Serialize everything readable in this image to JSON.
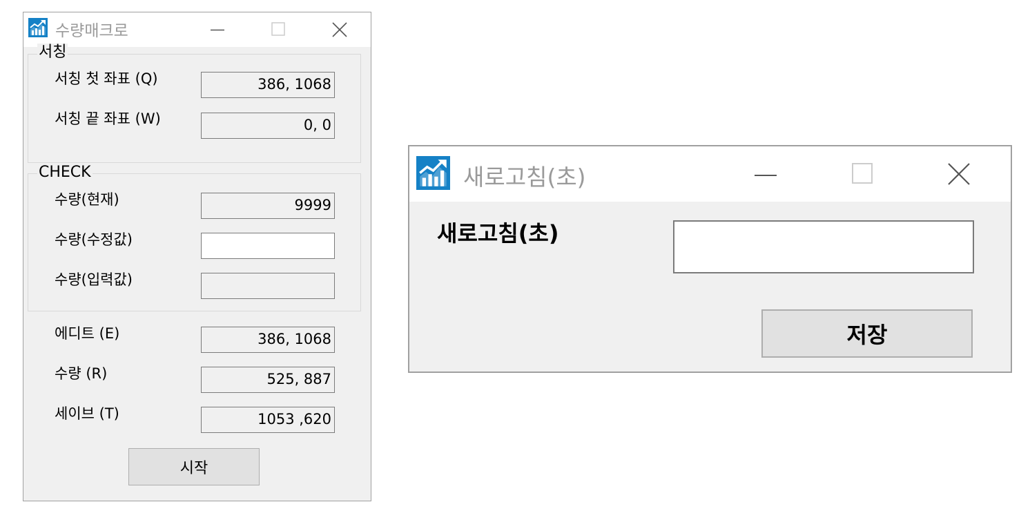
{
  "colors": {
    "window_bg": "#f0f0f0",
    "titlebar_bg": "#ffffff",
    "icon_blue": "#1581c6",
    "title_text": "#9a9a9a",
    "field_border": "#7a7a7a",
    "button_bg": "#e1e1e1"
  },
  "window1": {
    "title": "수량매크로",
    "icons": {
      "app": "chart-icon",
      "minimize": "minimize-icon",
      "maximize": "maximize-icon",
      "close": "close-icon"
    },
    "group_searching": {
      "title": "서칭",
      "first_label": "서칭 첫 좌표 (Q)",
      "first_value": "386, 1068",
      "last_label": "서칭 끝 좌표 (W)",
      "last_value": "0, 0"
    },
    "group_check": {
      "title": "CHECK",
      "current_label": "수량(현재)",
      "current_value": "9999",
      "modified_label": "수량(수정값)",
      "modified_value": "",
      "input_label": "수량(입력값)",
      "input_value": ""
    },
    "edit_label": "에디트 (E)",
    "edit_value": "386, 1068",
    "quantity_label": "수량 (R)",
    "quantity_value": "525, 887",
    "save_label": "세이브 (T)",
    "save_value": "1053 ,620",
    "start_button": "시작"
  },
  "window2": {
    "title": "새로고침(초)",
    "icons": {
      "app": "chart-icon",
      "minimize": "minimize-icon",
      "maximize": "maximize-icon",
      "close": "close-icon"
    },
    "refresh_label": "새로고침(초)",
    "refresh_value": "",
    "save_button": "저장"
  }
}
